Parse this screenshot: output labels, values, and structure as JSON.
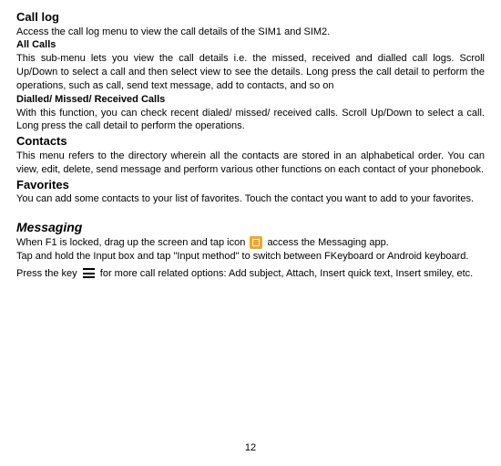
{
  "sections": {
    "callLog": {
      "title": "Call log",
      "intro": "Access the call log menu to view the call details of the SIM1 and SIM2.",
      "allCalls": {
        "title": "All Calls",
        "body": "This sub-menu lets you view the call details i.e. the missed, received and dialled call logs. Scroll Up/Down to select a call and then select view to see the details. Long press the call detail to perform the operations, such as call, send text message, add to contacts, and so on"
      },
      "dmr": {
        "title": "Dialled/ Missed/ Received Calls",
        "body": "With this function, you can check recent dialed/ missed/ received calls. Scroll Up/Down to select a call. Long press the call detail to perform the operations."
      }
    },
    "contacts": {
      "title": "Contacts",
      "body": "This menu refers to the directory wherein all the contacts are stored in an alphabetical order. You can view, edit, delete, send message and perform various other functions on each contact of your phonebook."
    },
    "favorites": {
      "title": "Favorites",
      "body": "You can add some contacts to your list of favorites. Touch the contact you want to add to your favorites."
    },
    "messaging": {
      "title": "Messaging",
      "p1a": "When F1 is locked, drag up the screen and tap icon ",
      "p1b": " access the Messaging app.",
      "p2": "Tap and hold the Input box and tap \"Input method\" to switch between FKeyboard or Android keyboard.",
      "p3a": "Press the key  ",
      "p3b": " for more call related options: Add subject, Attach, Insert quick text, Insert smiley, etc."
    }
  },
  "pageNumber": "12"
}
